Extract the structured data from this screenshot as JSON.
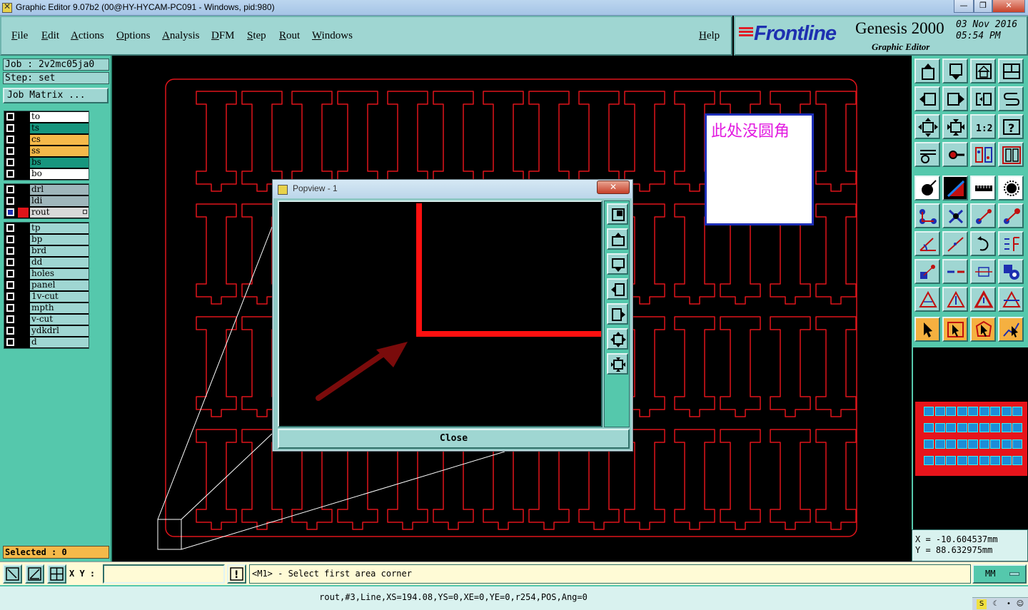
{
  "window": {
    "title": "Graphic Editor 9.07b2 (00@HY-HYCAM-PC091 - Windows, pid:980)",
    "min_label": "—",
    "max_label": "❐",
    "close_label": "✕"
  },
  "menu": {
    "items": [
      "File",
      "Edit",
      "Actions",
      "Options",
      "Analysis",
      "DFM",
      "Step",
      "Rout",
      "Windows"
    ],
    "help": "Help"
  },
  "brand": {
    "logo": "Frontline",
    "product": "Genesis 2000",
    "subtitle": "Graphic Editor",
    "date": "03 Nov 2016",
    "time": "05:54 PM",
    "logo_color": "#1d2fb0"
  },
  "job": {
    "job_line": "Job : 2v2mc05ja0",
    "step_line": "Step: set",
    "matrix_button": "Job Matrix ...",
    "selected": "Selected : 0"
  },
  "layer_groups": [
    [
      {
        "name": "to",
        "color": "#ffffff"
      },
      {
        "name": "ts",
        "color": "#17967e"
      },
      {
        "name": "cs",
        "color": "#f5b94a"
      },
      {
        "name": "ss",
        "color": "#f5b94a"
      },
      {
        "name": "bs",
        "color": "#17967e"
      },
      {
        "name": "bo",
        "color": "#ffffff"
      }
    ],
    [
      {
        "name": "drl",
        "color": "#9fb6bb"
      },
      {
        "name": "ldi",
        "color": "#9fb6bb"
      },
      {
        "name": "rout",
        "color": "#d9d9d9",
        "active": true
      }
    ],
    [
      {
        "name": "tp",
        "color": "#9fd6d2"
      },
      {
        "name": "bp",
        "color": "#9fd6d2"
      },
      {
        "name": "brd",
        "color": "#9fd6d2"
      },
      {
        "name": "dd",
        "color": "#9fd6d2"
      },
      {
        "name": "holes",
        "color": "#9fd6d2"
      },
      {
        "name": "panel",
        "color": "#9fd6d2"
      },
      {
        "name": "1v-cut",
        "color": "#9fd6d2"
      },
      {
        "name": "mpth",
        "color": "#9fd6d2"
      },
      {
        "name": "v-cut",
        "color": "#9fd6d2"
      },
      {
        "name": "ydkdrl",
        "color": "#9fd6d2"
      },
      {
        "name": "d",
        "color": "#9fd6d2"
      }
    ]
  ],
  "annotation": {
    "text": "此处没圆角",
    "text_color": "#e21ae0"
  },
  "popview": {
    "title": "Popview - 1",
    "close_x": "✕",
    "close_button": "Close"
  },
  "coordinates": {
    "x": "X = -10.604537mm",
    "y": "Y = 88.632975mm"
  },
  "command": {
    "xy_label": "X Y :",
    "xy_value": "",
    "warn": "!",
    "prompt": "<M1> - Select first area corner",
    "units": "MM"
  },
  "status": {
    "text": "rout,#3,Line,XS=194.08,YS=0,XE=0,YE=0,r254,POS,Ang=0"
  },
  "colors": {
    "rout_red": "#e0141a",
    "panel_teal": "#55c8ac",
    "button_teal": "#9fd6d2"
  }
}
